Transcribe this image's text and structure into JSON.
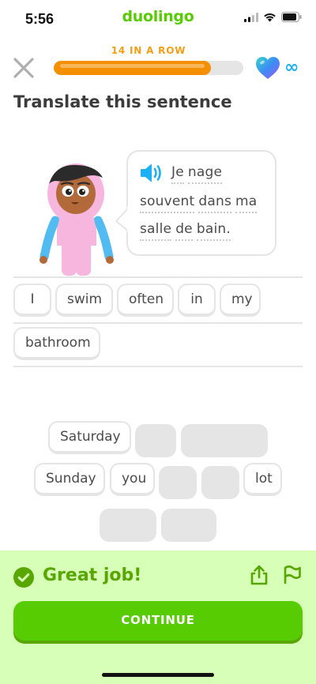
{
  "status_bar": {
    "time": "5:56",
    "app_name": "duolingo",
    "icons": [
      "cellular-signal-icon",
      "wifi-icon",
      "battery-icon"
    ]
  },
  "header": {
    "close_icon": "close-icon",
    "streak_label": "14 IN A ROW",
    "progress_fraction": 0.83,
    "hearts_icon": "heart-icon",
    "hearts_value": "∞",
    "accent_color": "#f49000"
  },
  "prompt": {
    "title": "Translate this sentence"
  },
  "speech_bubble": {
    "speaker_icon": "speaker-icon",
    "lines": [
      [
        "Je",
        "nage"
      ],
      [
        "souvent",
        "dans",
        "ma"
      ],
      [
        "salle",
        "de",
        "bain."
      ]
    ]
  },
  "answer": {
    "words": [
      "I",
      "swim",
      "often",
      "in",
      "my",
      "bathroom"
    ]
  },
  "word_bank": {
    "visible_words": [
      "Saturday",
      "Sunday",
      "you",
      "lot"
    ]
  },
  "feedback": {
    "status_icon": "check-circle-icon",
    "message": "Great job!",
    "share_icon": "share-icon",
    "flag_icon": "flag-icon",
    "continue_label": "CONTINUE",
    "success_color": "#58cc02"
  }
}
